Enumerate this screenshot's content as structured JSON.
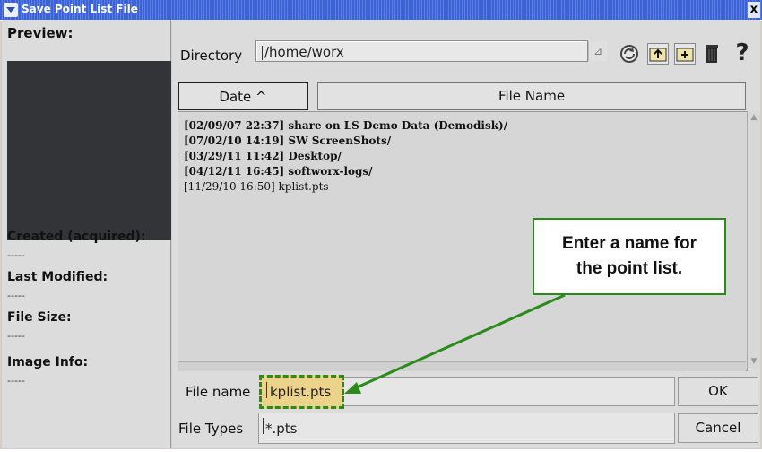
{
  "window": {
    "title": "Save Point List File",
    "close_glyph": "x"
  },
  "left": {
    "preview_label": "Preview:",
    "created_label": "Created (acquired):",
    "created_value": "-----",
    "modified_label": "Last Modified:",
    "modified_value": "-----",
    "size_label": "File Size:",
    "size_value": "-----",
    "info_label": "Image Info:",
    "info_value": "-----"
  },
  "directory": {
    "label": "Directory",
    "value": "/home/worx"
  },
  "toolbar": {
    "icons": [
      "refresh-icon",
      "parent-folder-icon",
      "new-folder-icon",
      "trash-icon",
      "help-icon"
    ],
    "help_glyph": "?"
  },
  "list": {
    "columns": [
      {
        "label": "Date ^"
      },
      {
        "label": "File Name"
      }
    ],
    "rows": [
      {
        "date": "[02/09/07 22:37]",
        "name": "share on LS Demo Data (Demodisk)/",
        "is_dir": true
      },
      {
        "date": "[07/02/10 14:19]",
        "name": "SW ScreenShots/",
        "is_dir": true
      },
      {
        "date": "[03/29/11 11:42]",
        "name": "Desktop/",
        "is_dir": true
      },
      {
        "date": "[04/12/11 16:45]",
        "name": "softworx-logs/",
        "is_dir": true
      },
      {
        "date": "[11/29/10 16:50]",
        "name": "kplist.pts",
        "is_dir": false
      }
    ]
  },
  "file_name": {
    "label": "File name",
    "value": "kplist.pts"
  },
  "file_types": {
    "label": "File Types",
    "value": "*.pts"
  },
  "buttons": {
    "ok": "OK",
    "cancel": "Cancel"
  },
  "callout": {
    "line1": "Enter a name for",
    "line2": "the point list."
  },
  "colors": {
    "callout_border": "#2a8a1a",
    "highlight": "#ecd38c",
    "titlebar": "#3c62d3"
  }
}
